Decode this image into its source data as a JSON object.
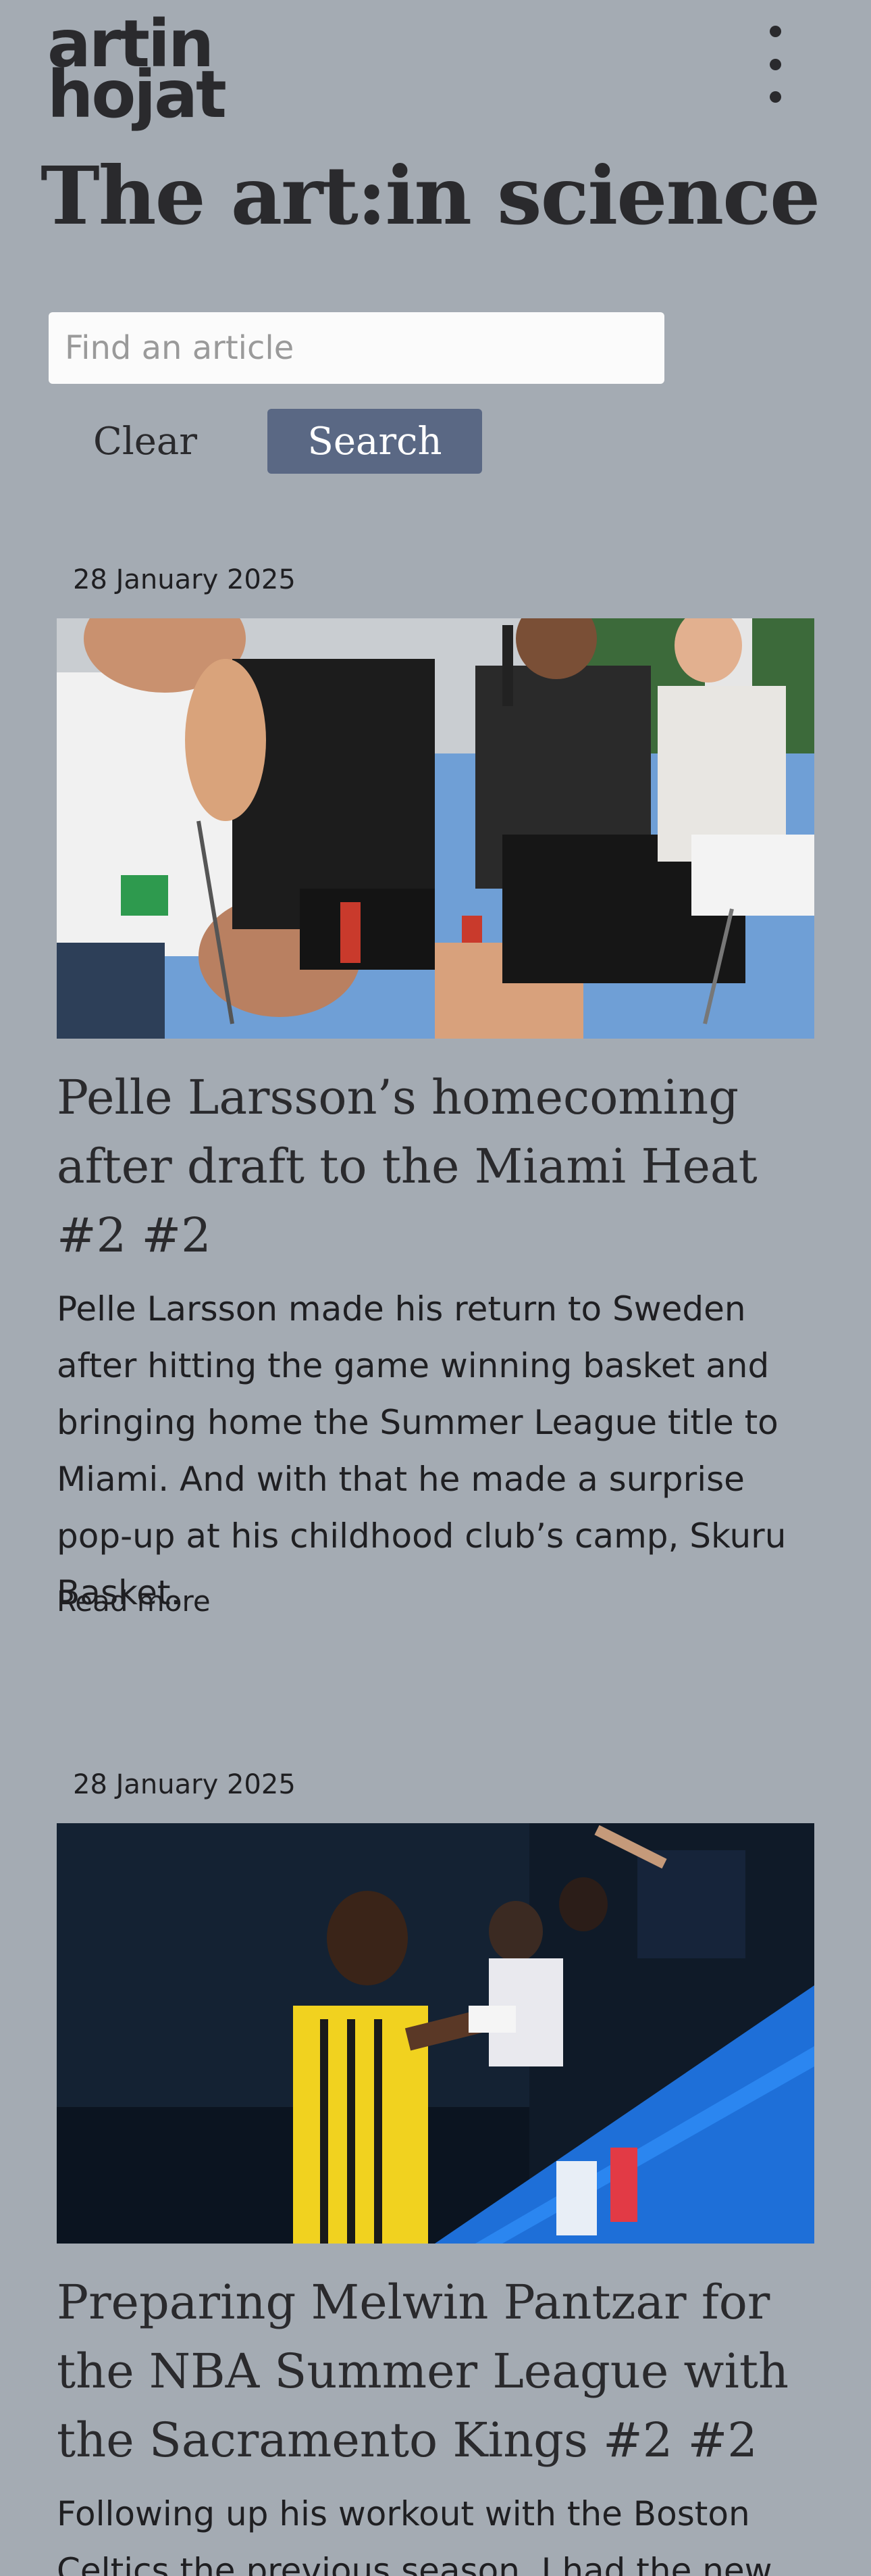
{
  "header": {
    "logo_line1": "artin",
    "logo_line2": "hojat",
    "menu_icon": "kebab-menu-icon"
  },
  "site_title": "The art:in science",
  "search": {
    "placeholder": "Find an article",
    "value": "",
    "clear_label": "Clear",
    "search_label": "Search",
    "search_button_color": "#5a6884"
  },
  "articles": [
    {
      "date": "28 January 2025",
      "title": "Pelle Larsson’s homecoming after draft to the Miami Heat #2 #2",
      "excerpt": "Pelle Larsson made his return to Sweden after hitting the game winning basket and bringing home the Summer League title to Miami. And with that he made a surprise pop-up at his childhood club’s camp, Skuru Basket.",
      "read_more": "Read more"
    },
    {
      "date": "28 January 2025",
      "title": "Preparing Melwin Pantzar for the NBA Summer League with the Sacramento Kings #2 #2",
      "excerpt": "Following up his workout with the Boston Celtics the previous season, I had the new"
    }
  ],
  "colors": {
    "background": "#a4abb3",
    "text": "#1f1f22",
    "accent": "#5a6884"
  }
}
